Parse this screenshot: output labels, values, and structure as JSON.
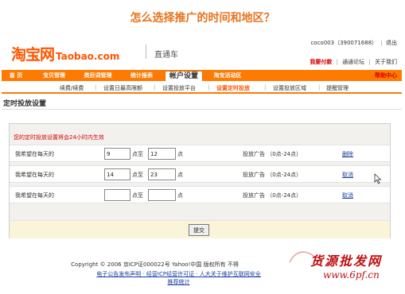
{
  "headline": "怎么选择推广的时间和地区？",
  "brand": {
    "logo_cn": "淘宝网",
    "logo_en": "Taobao.com",
    "product": "直通车"
  },
  "account": {
    "user": "coco003（390071688）",
    "logout": "退出"
  },
  "toplinks": {
    "pay": "我要付款",
    "forum": "通通论坛",
    "about": "关于我们"
  },
  "nav": {
    "tabs": [
      {
        "label": "首 页"
      },
      {
        "label": "宝贝管理"
      },
      {
        "label": "类目词管理"
      },
      {
        "label": "统计报表"
      },
      {
        "label": "帐户设置"
      },
      {
        "label": "淘宝活动区"
      }
    ],
    "active_index": 4,
    "help": "帮助中心"
  },
  "subnav": {
    "items": [
      {
        "label": "续费/续费"
      },
      {
        "label": "设置日最高限额"
      },
      {
        "label": "设置投放平台"
      },
      {
        "label": "设置定时投放"
      },
      {
        "label": "设置投放区域"
      },
      {
        "label": "提醒管理"
      }
    ],
    "active_index": 3
  },
  "section_title": "定时投放设置",
  "notice": "您的定时投放设置将会24小时内生效",
  "rows": [
    {
      "label": "我希望在每天的",
      "start": "9",
      "end": "12",
      "to": "点至",
      "unit": "点",
      "ad": "投放广告 （0点-24点）",
      "action": "删除"
    },
    {
      "label": "我希望在每天的",
      "start": "14",
      "end": "23",
      "to": "点至",
      "unit": "点",
      "ad": "投放广告 （0点-24点）",
      "action": "取消"
    },
    {
      "label": "我希望在每天的",
      "start": "",
      "end": "",
      "to": "点至",
      "unit": "点",
      "ad": "投放广告 （0点-24点）",
      "action": "取消"
    }
  ],
  "submit_label": "提交",
  "footer": {
    "line1": "Copyright © 2006 京ICP证000022号  Yahoo!中国 版权所有  不得",
    "line2": "电子公告发布声明 · 经营ICP经营许可证 · 人大关于维护互联网安全",
    "line3": "推荐统计"
  },
  "watermark": {
    "text": "货源批发网",
    "url": "www.6pf.cn"
  },
  "colors": {
    "accent": "#ff7a00",
    "brand": "#ff5500",
    "headline": "#e8731c",
    "link": "#1a3f9e",
    "alert": "#d40000"
  }
}
